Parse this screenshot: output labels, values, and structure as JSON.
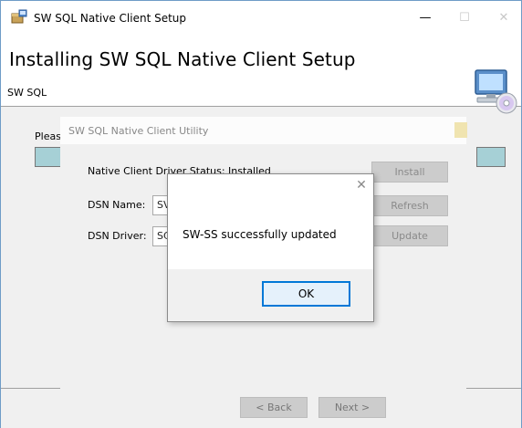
{
  "window": {
    "title": "SW SQL Native Client Setup",
    "minimize_glyph": "—",
    "maximize_glyph": "☐",
    "close_glyph": "✕"
  },
  "header": {
    "title": "Installing SW SQL Native Client Setup"
  },
  "body": {
    "label_truncated": "SW SQL",
    "please_truncated": "Pleas"
  },
  "wizard": {
    "back_label": "< Back",
    "next_label": "Next >"
  },
  "utility": {
    "title": "SW SQL Native Client Utility",
    "status_label": "Native Client Driver Status: Installed",
    "dsn_name_label": "DSN Name:",
    "dsn_name_value": "SV",
    "dsn_driver_label": "DSN Driver:",
    "dsn_driver_value": "SC",
    "install_label": "Install",
    "refresh_label": "Refresh",
    "update_label": "Update"
  },
  "message": {
    "text": "SW-SS successfully updated",
    "ok_label": "OK",
    "close_glyph": "✕"
  },
  "colors": {
    "accent": "#0078d7",
    "window_border": "#6f9cc7",
    "teal": "#a6d0d6"
  },
  "icons": {
    "app": "installer-box-icon",
    "header": "computer-cd-icon"
  }
}
